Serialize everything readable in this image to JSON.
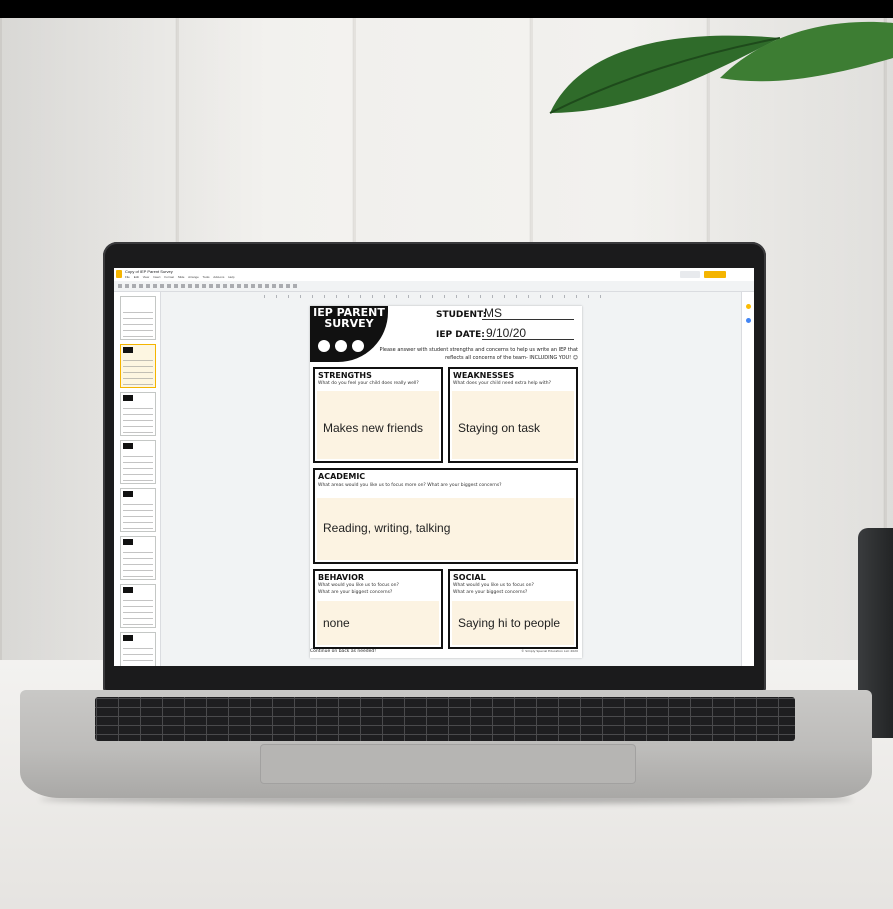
{
  "app": {
    "doc_title": "Copy of IEP Parent Survey",
    "menu": [
      "File",
      "Edit",
      "View",
      "Insert",
      "Format",
      "Slide",
      "Arrange",
      "Tools",
      "Add-ons",
      "Help"
    ],
    "present_label": "",
    "share_label": ""
  },
  "slide": {
    "badge_title": "IEP PARENT SURVEY",
    "student_label": "STUDENT:",
    "student_value": "MS",
    "iep_date_label": "IEP DATE:",
    "iep_date_value": "9/10/20",
    "intro_text": "Please answer with student strengths and concerns to help us write an IEP that reflects all concerns of the team- INCLUDING YOU! ☺",
    "strengths": {
      "title": "STRENGTHS",
      "question": "What do you feel your child does really well?",
      "answer": "Makes new friends"
    },
    "weaknesses": {
      "title": "WEAKNESSES",
      "question": "What does your child need extra help with?",
      "answer": "Staying on task"
    },
    "academic": {
      "title": "ACADEMIC",
      "question": "What areas would you like us to focus more on? What are your biggest concerns?",
      "answer": "Reading, writing, talking"
    },
    "behavior": {
      "title": "BEHAVIOR",
      "question1": "What would you like us to focus on?",
      "question2": "What are your biggest concerns?",
      "answer": "none"
    },
    "social": {
      "title": "SOCIAL",
      "question1": "What would you like us to focus on?",
      "question2": "What are your biggest concerns?",
      "answer": "Saying hi to people"
    },
    "footer_left": "Continue on back as needed!",
    "footer_right": "© Simply Special Education LLC 2020"
  },
  "colors": {
    "answer_fill": "#fcf3e2",
    "accent_yellow": "#f4b400"
  }
}
